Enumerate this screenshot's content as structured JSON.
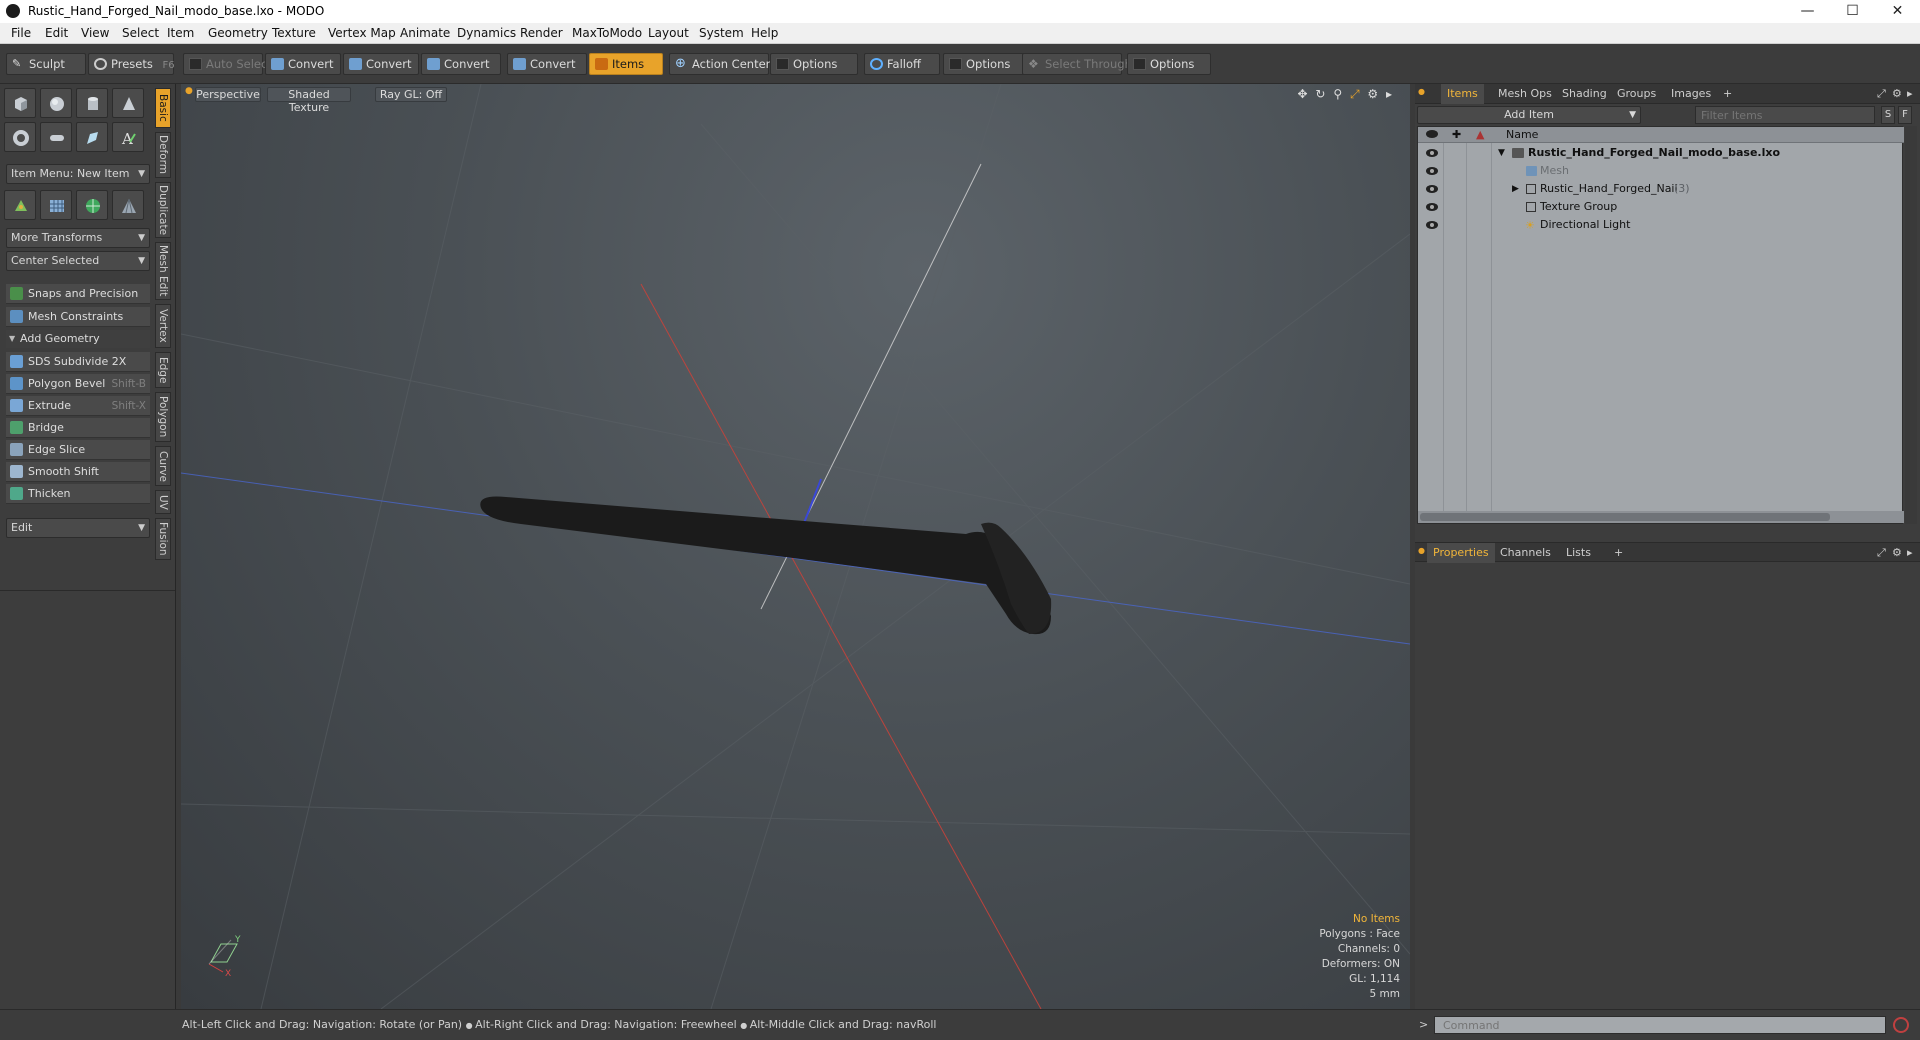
{
  "window": {
    "title": "Rustic_Hand_Forged_Nail_modo_base.lxo - MODO"
  },
  "menu": [
    "File",
    "Edit",
    "View",
    "Select",
    "Item",
    "Geometry",
    "Texture",
    "Vertex Map",
    "Animate",
    "Dynamics",
    "Render",
    "MaxToModo",
    "Layout",
    "System",
    "Help"
  ],
  "toolbar": {
    "sculpt": "Sculpt",
    "presets": "Presets",
    "presets_key": "F6",
    "auto_select": "Auto Select",
    "convert1": "Convert",
    "convert2": "Convert",
    "convert3": "Convert",
    "convert4": "Convert",
    "items": "Items",
    "action_center": "Action Center",
    "options1": "Options",
    "falloff": "Falloff",
    "options2": "Options",
    "select_through": "Select Through",
    "options3": "Options"
  },
  "left": {
    "item_menu": "Item Menu: New Item",
    "more_transforms": "More Transforms",
    "center_selected": "Center Selected",
    "snaps": "Snaps and Precision",
    "constraints": "Mesh Constraints",
    "add_geometry": "Add Geometry",
    "tools": [
      {
        "label": "SDS Subdivide 2X",
        "shortcut": ""
      },
      {
        "label": "Polygon Bevel",
        "shortcut": "Shift-B"
      },
      {
        "label": "Extrude",
        "shortcut": "Shift-X"
      },
      {
        "label": "Bridge",
        "shortcut": ""
      },
      {
        "label": "Edge Slice",
        "shortcut": ""
      },
      {
        "label": "Smooth Shift",
        "shortcut": ""
      },
      {
        "label": "Thicken",
        "shortcut": ""
      }
    ],
    "edit_dropdown": "Edit",
    "vtabs": [
      "Basic",
      "Deform",
      "Duplicate",
      "Mesh Edit",
      "Vertex",
      "Edge",
      "Polygon",
      "Curve",
      "UV",
      "Fusion"
    ]
  },
  "viewport": {
    "view": "Perspective",
    "shading": "Shaded Texture",
    "raygl": "Ray GL: Off",
    "info": {
      "no_items": "No Items",
      "polygons": "Polygons : Face",
      "channels": "Channels: 0",
      "deformers": "Deformers: ON",
      "gl": "GL: 1,114",
      "scale": "5 mm"
    },
    "axis_y": "Y",
    "axis_x": "X"
  },
  "right": {
    "tabs": [
      "Items",
      "Mesh Ops",
      "Shading",
      "Groups",
      "Images"
    ],
    "add_item": "Add Item",
    "filter_placeholder": "Filter Items",
    "filter_s": "S",
    "filter_f": "F",
    "col_name": "Name",
    "tree": [
      {
        "label": "Rustic_Hand_Forged_Nail_modo_base.lxo",
        "count": ""
      },
      {
        "label": "Mesh",
        "count": ""
      },
      {
        "label": "Rustic_Hand_Forged_Nail",
        "count": "(3)"
      },
      {
        "label": "Texture Group",
        "count": ""
      },
      {
        "label": "Directional Light",
        "count": ""
      }
    ],
    "bottom_tabs": [
      "Properties",
      "Channels",
      "Lists"
    ]
  },
  "status": {
    "hint1": "Alt-Left Click and Drag: Navigation: Rotate (or Pan)",
    "hint2": "Alt-Right Click and Drag: Navigation: Freewheel",
    "hint3": "Alt-Middle Click and Drag: navRoll",
    "command_placeholder": "Command"
  }
}
